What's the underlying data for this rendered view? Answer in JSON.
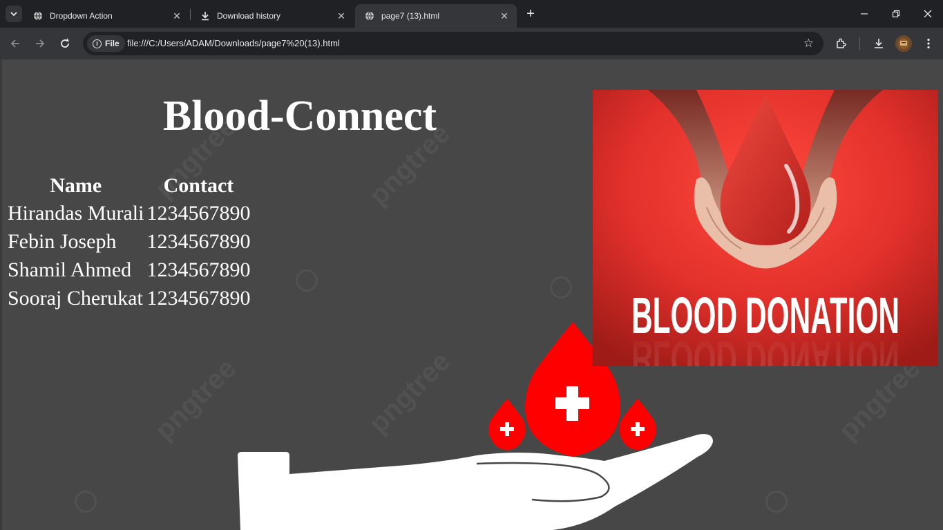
{
  "browser": {
    "tabs": [
      {
        "title": "Dropdown Action",
        "icon": "globe-icon",
        "active": false
      },
      {
        "title": "Download history",
        "icon": "download-icon",
        "active": false
      },
      {
        "title": "page7 (13).html",
        "icon": "globe-icon",
        "active": true
      }
    ],
    "security_chip": "File",
    "url": "file:///C:/Users/ADAM/Downloads/page7%20(13).html"
  },
  "page": {
    "title": "Blood-Connect",
    "table": {
      "headers": [
        "Name",
        "Contact"
      ],
      "rows": [
        {
          "name": "Hirandas Murali",
          "contact": "1234567890"
        },
        {
          "name": "Febin Joseph",
          "contact": "1234567890"
        },
        {
          "name": "Shamil Ahmed",
          "contact": "1234567890"
        },
        {
          "name": "Sooraj Cherukat",
          "contact": "1234567890"
        }
      ]
    },
    "poster_text": "BLOOD DONATION",
    "watermark_text": "pngtree",
    "colors": {
      "page_background": "#474747",
      "blood_red": "#ff0000",
      "poster_red": "#e2302b"
    }
  }
}
